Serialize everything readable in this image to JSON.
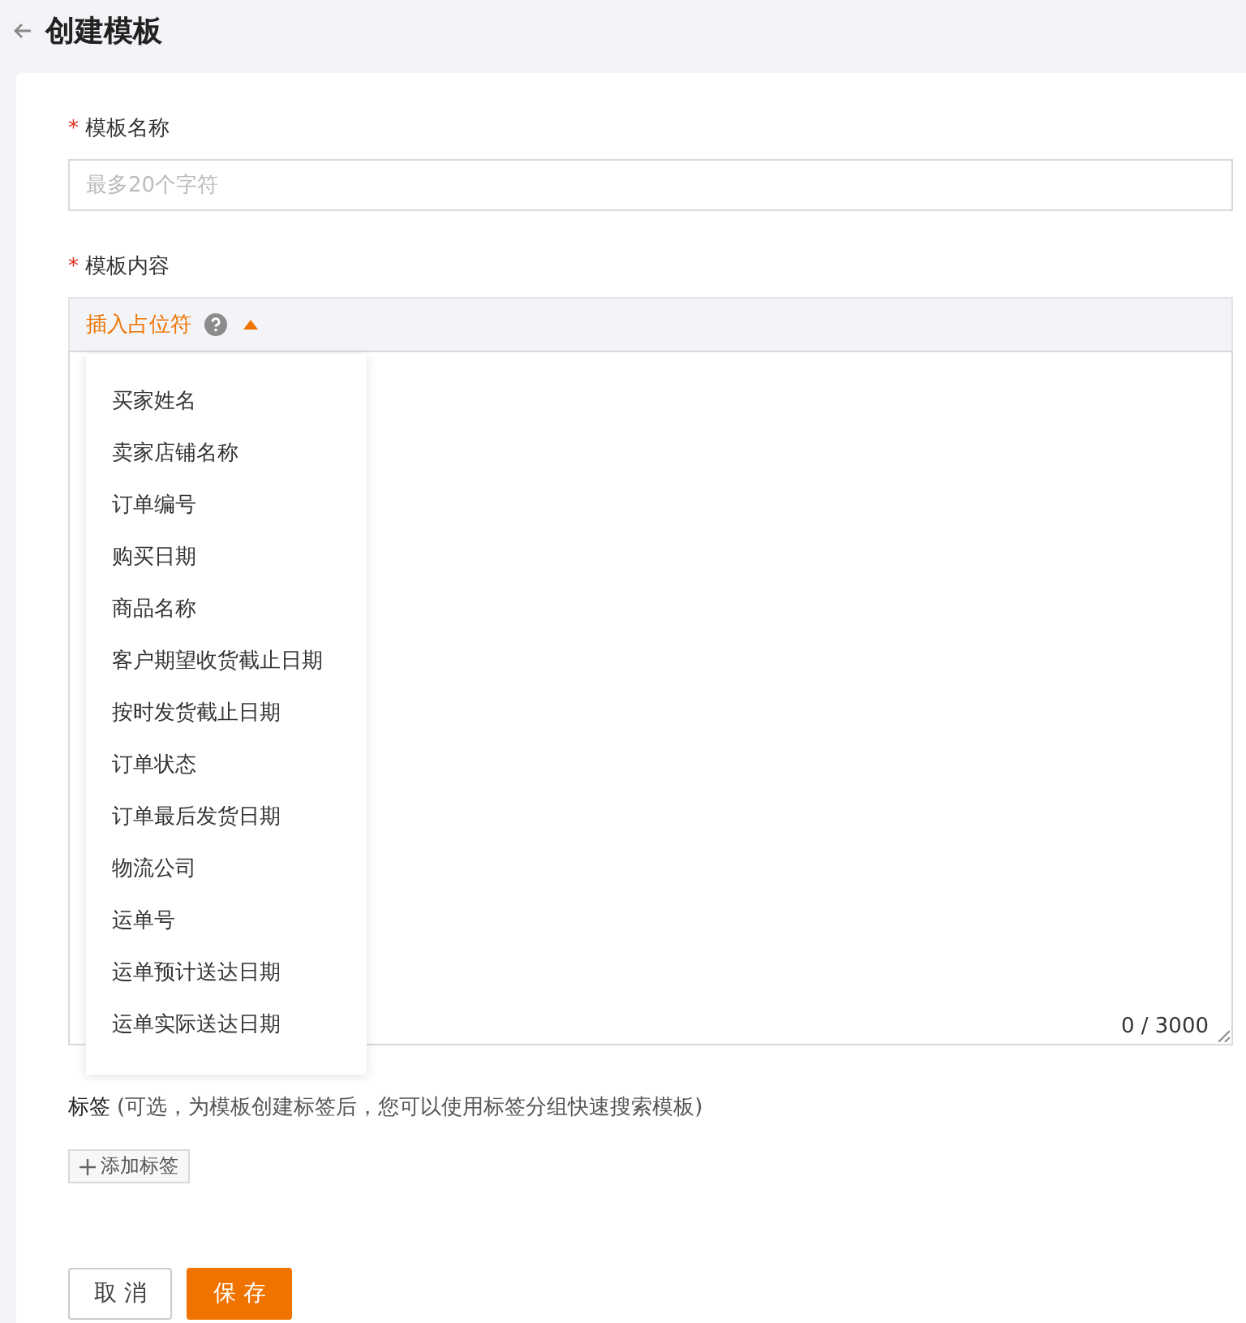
{
  "header": {
    "title": "创建模板"
  },
  "fields": [
    {
      "label": "模板名称",
      "required_mark": "*",
      "placeholder": "最多20个字符"
    }
  ],
  "content": {
    "label": "模板内容",
    "required_mark": "*",
    "insert_label": "插入占位符",
    "expanded": true,
    "counter": "0 / 3000",
    "placeholders": [
      "买家姓名",
      "卖家店铺名称",
      "订单编号",
      "购买日期",
      "商品名称",
      "客户期望收货截止日期",
      "按时发货截止日期",
      "订单状态",
      "订单最后发货日期",
      "物流公司",
      "运单号",
      "运单预计送达日期",
      "运单实际送达日期"
    ]
  },
  "tags": {
    "label": "标签",
    "hint": "(可选，为模板创建标签后，您可以使用标签分组快速搜索模板)",
    "add_button": "添加标签"
  },
  "buttons": {
    "cancel": "取 消",
    "save": "保 存"
  }
}
